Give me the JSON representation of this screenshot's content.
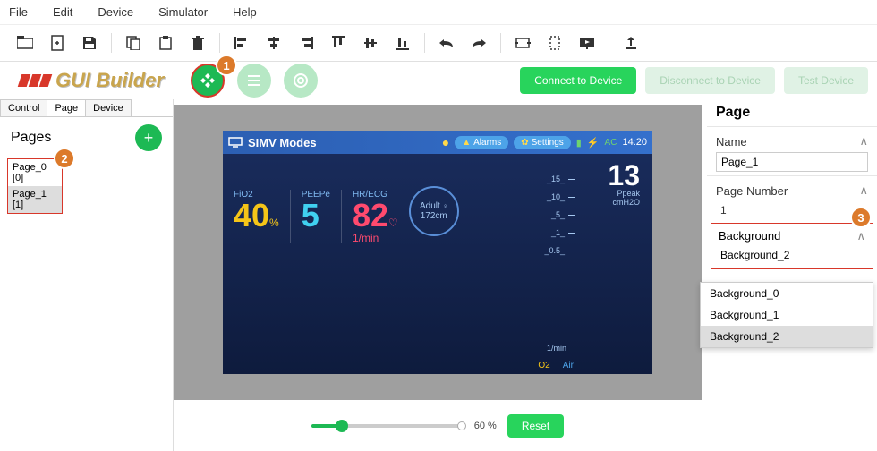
{
  "menu": {
    "file": "File",
    "edit": "Edit",
    "device": "Device",
    "simulator": "Simulator",
    "help": "Help"
  },
  "brand": "GUI Builder",
  "buttons": {
    "connect": "Connect to Device",
    "disconnect": "Disconnect to Device",
    "test": "Test Device",
    "reset": "Reset"
  },
  "badges": {
    "b1": "1",
    "b2": "2",
    "b3": "3"
  },
  "tabs": {
    "control": "Control",
    "page": "Page",
    "device": "Device"
  },
  "pages_title": "Pages",
  "page_list": [
    "Page_0 [0]",
    "Page_1 [1]"
  ],
  "zoom": "60 %",
  "props": {
    "title": "Page",
    "name_label": "Name",
    "name_value": "Page_1",
    "number_label": "Page Number",
    "number_value": "1",
    "bg_label": "Background",
    "bg_value": "Background_2",
    "bg_options": [
      "Background_0",
      "Background_1",
      "Background_2"
    ]
  },
  "screen": {
    "mode": "SIMV Modes",
    "alarms": "Alarms",
    "settings": "Settings",
    "ac": "AC",
    "time": "14:20",
    "big": "13",
    "ppeak": "Ppeak",
    "unit": "cmH2O",
    "fio2_lbl": "FiO2",
    "fio2_val": "40",
    "fio2_unit": "%",
    "peep_lbl": "PEEPe",
    "peep_val": "5",
    "hr_lbl": "HR/ECG",
    "hr_val": "82",
    "hr_unit": "1/min",
    "adult": "Adult",
    "height": "172cm",
    "scale": [
      "_15_",
      "_10_",
      "_5_",
      "_1_",
      "_0.5_"
    ],
    "lmin": "1/min",
    "o2": "O2",
    "air": "Air"
  }
}
